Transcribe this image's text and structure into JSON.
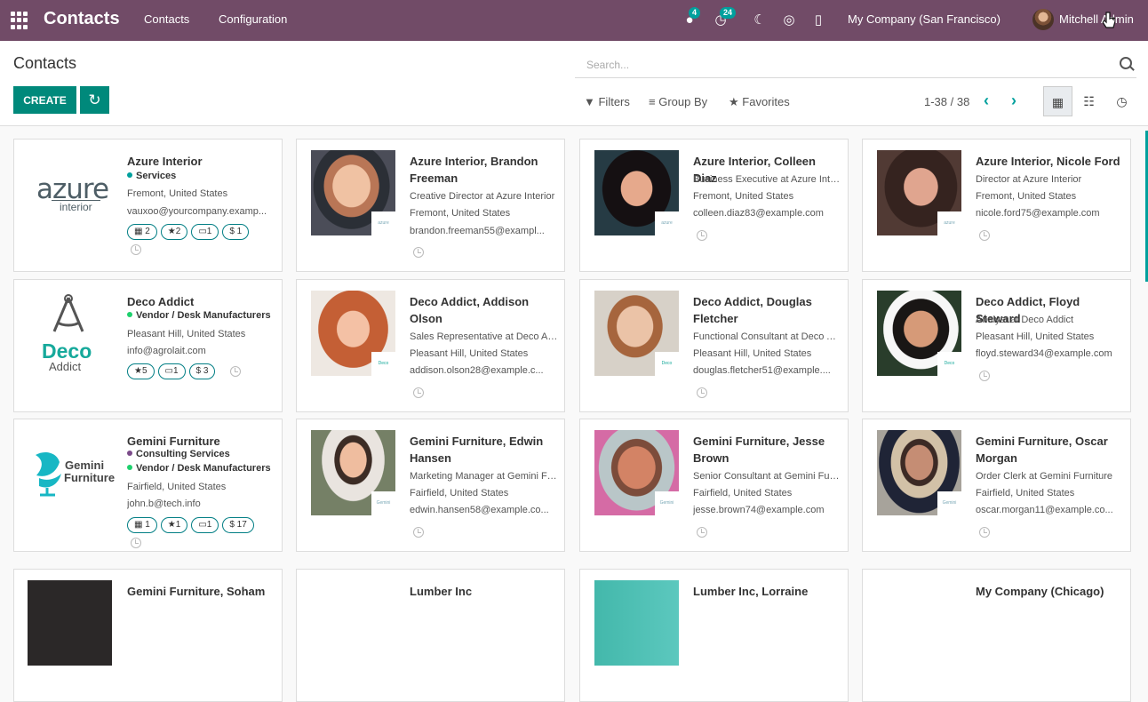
{
  "topbar": {
    "app": "Contacts",
    "menus": [
      "Contacts",
      "Configuration"
    ],
    "message_count": "4",
    "activity_count": "24",
    "company": "My Company (San Francisco)",
    "user": "Mitchell Admin"
  },
  "control": {
    "title": "Contacts",
    "create": "CREATE",
    "search_placeholder": "Search...",
    "filters": "Filters",
    "group_by": "Group By",
    "favorites": "Favorites",
    "pager": "1-38 / 38"
  },
  "cards": [
    {
      "name": "Azure Interior",
      "line1": "Services",
      "line2": "Fremont, United States",
      "line3": "vauxoo@yourcompany.examp...",
      "tags": [
        "Services"
      ],
      "pills": [
        "2",
        "2",
        "1",
        "$ 1"
      ]
    },
    {
      "name": "Azure Interior, Brandon Freeman",
      "line1": "Creative Director at Azure Interior",
      "line2": "Fremont, United States",
      "line3": "brandon.freeman55@exampl..."
    },
    {
      "name": "Azure Interior, Colleen Diaz",
      "line1": "Business Executive at Azure Inter...",
      "line2": "Fremont, United States",
      "line3": "colleen.diaz83@example.com"
    },
    {
      "name": "Azure Interior, Nicole Ford",
      "line1": "Director at Azure Interior",
      "line2": "Fremont, United States",
      "line3": "nicole.ford75@example.com"
    },
    {
      "name": "Deco Addict",
      "line1": "Vendor / Desk Manufacturers",
      "line2": "Pleasant Hill, United States",
      "line3": "info@agrolait.com",
      "tags": [
        "Vendor / Desk Manufacturers"
      ],
      "pills": [
        "5",
        "1",
        "$ 3"
      ]
    },
    {
      "name": "Deco Addict, Addison Olson",
      "line1": "Sales Representative at Deco Ad...",
      "line2": "Pleasant Hill, United States",
      "line3": "addison.olson28@example.c..."
    },
    {
      "name": "Deco Addict, Douglas Fletcher",
      "line1": "Functional Consultant at Deco Ad...",
      "line2": "Pleasant Hill, United States",
      "line3": "douglas.fletcher51@example...."
    },
    {
      "name": "Deco Addict, Floyd Steward",
      "line1": "Analyst at Deco Addict",
      "line2": "Pleasant Hill, United States",
      "line3": "floyd.steward34@example.com"
    },
    {
      "name": "Gemini Furniture",
      "line1": "Consulting Services",
      "line2": "Vendor / Desk Manufacturers",
      "line3": "Fairfield, United States",
      "line4": "john.b@tech.info",
      "pills": [
        "1",
        "1",
        "1",
        "$ 17"
      ]
    },
    {
      "name": "Gemini Furniture, Edwin Hansen",
      "line1": "Marketing Manager at Gemini Fur...",
      "line2": "Fairfield, United States",
      "line3": "edwin.hansen58@example.co..."
    },
    {
      "name": "Gemini Furniture, Jesse Brown",
      "line1": "Senior Consultant at Gemini Furn...",
      "line2": "Fairfield, United States",
      "line3": "jesse.brown74@example.com"
    },
    {
      "name": "Gemini Furniture, Oscar Morgan",
      "line1": "Order Clerk at Gemini Furniture",
      "line2": "Fairfield, United States",
      "line3": "oscar.morgan11@example.co..."
    },
    {
      "name": "Gemini Furniture, Soham"
    },
    {
      "name": "Lumber Inc"
    },
    {
      "name": "Lumber Inc, Lorraine"
    },
    {
      "name": "My Company (Chicago)"
    }
  ],
  "logos": {
    "azure": "azure",
    "azure_sub": "interior",
    "deco": "Deco",
    "deco_sub": "Addict",
    "gemini": "Gemini",
    "gemini_sub": "Furniture"
  },
  "colors": {
    "brand": "#714b67",
    "accent": "#00a09d",
    "button": "#00897b"
  }
}
